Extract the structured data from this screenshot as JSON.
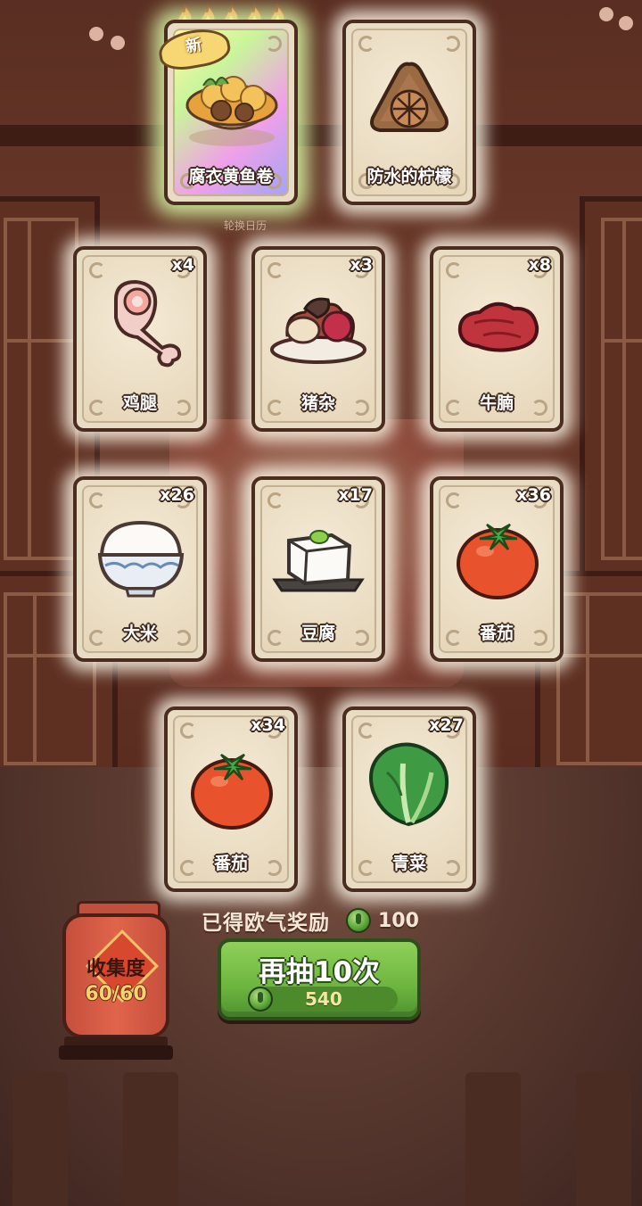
{
  "new_badge": "新",
  "calendar_label": "轮换日历",
  "cards": [
    {
      "label": "腐衣黄鱼卷",
      "qty": "",
      "icon": "fish-roll-dish-icon"
    },
    {
      "label": "防水的柠檬",
      "qty": "",
      "icon": "lemon-cake-icon"
    },
    {
      "label": "鸡腿",
      "qty": "x4",
      "icon": "chicken-leg-icon"
    },
    {
      "label": "猪杂",
      "qty": "x3",
      "icon": "pork-offal-icon"
    },
    {
      "label": "牛腩",
      "qty": "x8",
      "icon": "beef-brisket-icon"
    },
    {
      "label": "大米",
      "qty": "x26",
      "icon": "rice-bowl-icon"
    },
    {
      "label": "豆腐",
      "qty": "x17",
      "icon": "tofu-icon"
    },
    {
      "label": "番茄",
      "qty": "x36",
      "icon": "tomato-icon"
    },
    {
      "label": "番茄",
      "qty": "x34",
      "icon": "tomato-icon"
    },
    {
      "label": "青菜",
      "qty": "x27",
      "icon": "bok-choy-icon"
    }
  ],
  "reward": {
    "label": "已得欧气奖励",
    "value": "100",
    "icon": "green-coin-icon"
  },
  "draw_button": {
    "label": "再抽10次",
    "cost": "540",
    "icon": "green-coin-icon"
  },
  "collection": {
    "title": "收集度",
    "value": "60/60"
  },
  "rarity_flames": 5,
  "colors": {
    "card_bg": "#e9dcc4",
    "button_green": "#6cb53e",
    "lantern_red": "#e0644a"
  }
}
